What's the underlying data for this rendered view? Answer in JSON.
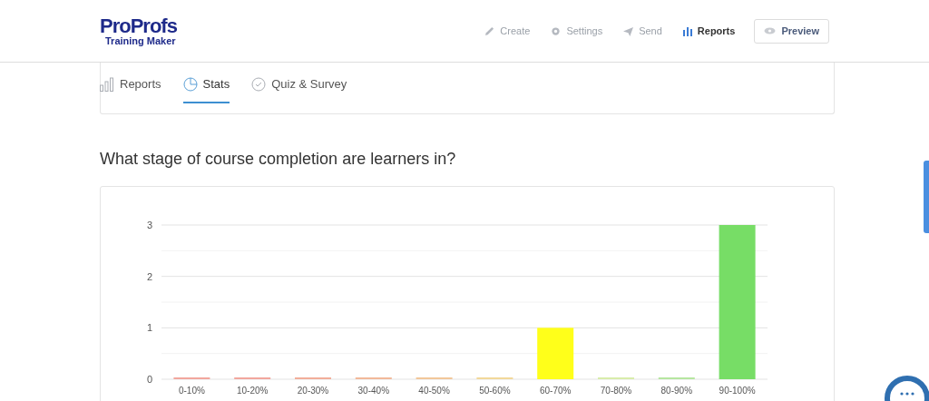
{
  "header": {
    "logo": {
      "brand": "ProProfs",
      "product": "Training Maker"
    },
    "nav": [
      {
        "label": "Create",
        "selected": false
      },
      {
        "label": "Settings",
        "selected": false
      },
      {
        "label": "Send",
        "selected": false
      },
      {
        "label": "Reports",
        "selected": true
      }
    ],
    "preview_button": "Preview"
  },
  "tabs": [
    {
      "label": "Reports",
      "selected": false
    },
    {
      "label": "Stats",
      "selected": true
    },
    {
      "label": "Quiz & Survey",
      "selected": false
    }
  ],
  "question": "What stage of course completion are learners in?",
  "chart": {
    "chart_data": {
      "type": "bar",
      "categories": [
        "0-10%",
        "10-20%",
        "20-30%",
        "30-40%",
        "40-50%",
        "50-60%",
        "60-70%",
        "70-80%",
        "80-90%",
        "90-100%"
      ],
      "series": [
        {
          "color": "#f2a79e",
          "values": [
            0,
            null,
            null,
            null,
            null,
            null,
            null,
            null,
            null,
            null
          ]
        },
        {
          "color": "#f2a79e",
          "values": [
            null,
            0,
            null,
            null,
            null,
            null,
            null,
            null,
            null,
            null
          ]
        },
        {
          "color": "#f2ae9a",
          "values": [
            null,
            null,
            0,
            null,
            null,
            null,
            null,
            null,
            null,
            null
          ]
        },
        {
          "color": "#f2b99a",
          "values": [
            null,
            null,
            null,
            0,
            null,
            null,
            null,
            null,
            null,
            null
          ]
        },
        {
          "color": "#f2c79a",
          "values": [
            null,
            null,
            null,
            null,
            0,
            null,
            null,
            null,
            null,
            null
          ]
        },
        {
          "color": "#f2d89a",
          "values": [
            null,
            null,
            null,
            null,
            null,
            0,
            null,
            null,
            null,
            null
          ]
        },
        {
          "color": "#ffff1a",
          "values": [
            null,
            null,
            null,
            null,
            null,
            null,
            1,
            null,
            null,
            null
          ]
        },
        {
          "color": "#d8ecaa",
          "values": [
            null,
            null,
            null,
            null,
            null,
            null,
            null,
            0,
            null,
            null
          ]
        },
        {
          "color": "#b6e6a0",
          "values": [
            null,
            null,
            null,
            null,
            null,
            null,
            null,
            null,
            0,
            null
          ]
        },
        {
          "color": "#77dd66",
          "values": [
            null,
            null,
            null,
            null,
            null,
            null,
            null,
            null,
            null,
            3
          ]
        }
      ],
      "ylim": [
        0,
        3
      ],
      "yticks": [
        0,
        1,
        2,
        3
      ]
    }
  }
}
